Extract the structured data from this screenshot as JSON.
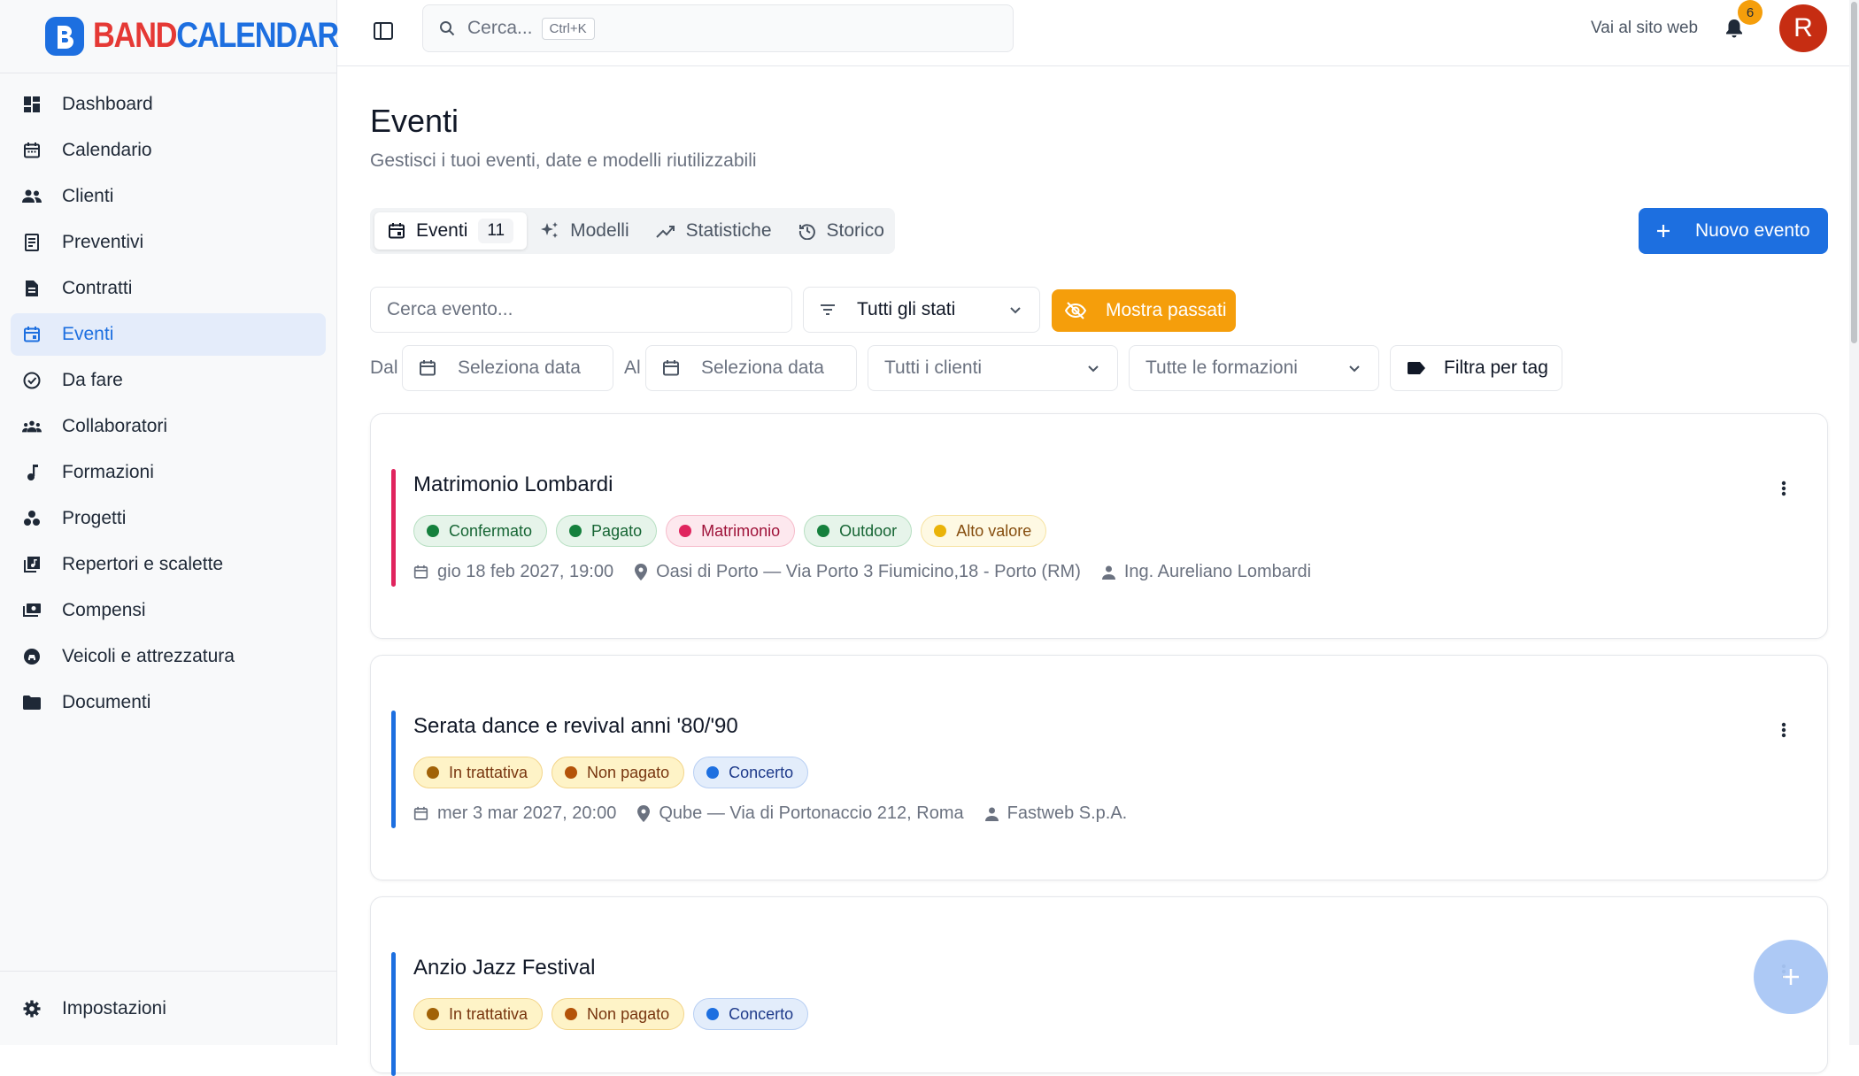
{
  "brand": {
    "part1": "BAND",
    "part2": "CALENDAR",
    "colors": {
      "red": "#e53935",
      "blue": "#1d6fe0"
    }
  },
  "sidebar": {
    "items": [
      {
        "label": "Dashboard",
        "icon": "dashboard-icon"
      },
      {
        "label": "Calendario",
        "icon": "calendar-icon"
      },
      {
        "label": "Clienti",
        "icon": "people-icon"
      },
      {
        "label": "Preventivi",
        "icon": "receipt-icon"
      },
      {
        "label": "Contratti",
        "icon": "document-icon"
      },
      {
        "label": "Eventi",
        "icon": "event-icon",
        "active": true
      },
      {
        "label": "Da fare",
        "icon": "check-circle-icon"
      },
      {
        "label": "Collaboratori",
        "icon": "groups-icon"
      },
      {
        "label": "Formazioni",
        "icon": "music-note-icon"
      },
      {
        "label": "Progetti",
        "icon": "workspaces-icon"
      },
      {
        "label": "Repertori e scalette",
        "icon": "library-music-icon"
      },
      {
        "label": "Compensi",
        "icon": "payments-icon"
      },
      {
        "label": "Veicoli e attrezzatura",
        "icon": "vehicle-icon"
      },
      {
        "label": "Documenti",
        "icon": "folder-icon"
      }
    ],
    "settings_label": "Impostazioni"
  },
  "topbar": {
    "search_placeholder": "Cerca...",
    "search_shortcut": "Ctrl+K",
    "visit_site": "Vai al sito web",
    "notifications_count": "6",
    "avatar_initial": "R"
  },
  "page": {
    "title": "Eventi",
    "subtitle": "Gestisci i tuoi eventi, date e modelli riutilizzabili",
    "tabs": [
      {
        "label": "Eventi",
        "count": "11",
        "active": true
      },
      {
        "label": "Modelli"
      },
      {
        "label": "Statistiche"
      },
      {
        "label": "Storico"
      }
    ],
    "new_event_label": "Nuovo evento"
  },
  "filters": {
    "search_placeholder": "Cerca evento...",
    "status_select": "Tutti gli stati",
    "show_past_label": "Mostra passati",
    "from_label": "Dal",
    "to_label": "Al",
    "date_placeholder": "Seleziona data",
    "clients_select": "Tutti i clienti",
    "formations_select": "Tutte le formazioni",
    "tag_filter_label": "Filtra per tag"
  },
  "events": [
    {
      "title": "Matrimonio Lombardi",
      "accent": "#e0245e",
      "badges": [
        {
          "label": "Confermato",
          "tone": "green"
        },
        {
          "label": "Pagato",
          "tone": "green"
        },
        {
          "label": "Matrimonio",
          "tone": "pink"
        },
        {
          "label": "Outdoor",
          "tone": "green"
        },
        {
          "label": "Alto valore",
          "tone": "yellow"
        }
      ],
      "date": "gio 18 feb 2027, 19:00",
      "location": "Oasi di Porto — Via Porto 3 Fiumicino,18 - Porto (RM)",
      "client": "Ing. Aureliano Lombardi"
    },
    {
      "title": "Serata dance e revival anni '80/'90",
      "accent": "#1d6fe0",
      "badges": [
        {
          "label": "In trattativa",
          "tone": "amber"
        },
        {
          "label": "Non pagato",
          "tone": "amber"
        },
        {
          "label": "Concerto",
          "tone": "blue"
        }
      ],
      "date": "mer 3 mar 2027, 20:00",
      "location": "Qube — Via di Portonaccio 212, Roma",
      "client": "Fastweb S.p.A."
    },
    {
      "title": "Anzio Jazz Festival",
      "accent": "#1d6fe0",
      "badges": [
        {
          "label": "In trattativa",
          "tone": "amber"
        },
        {
          "label": "Non pagato",
          "tone": "amber"
        },
        {
          "label": "Concerto",
          "tone": "blue"
        }
      ]
    }
  ]
}
